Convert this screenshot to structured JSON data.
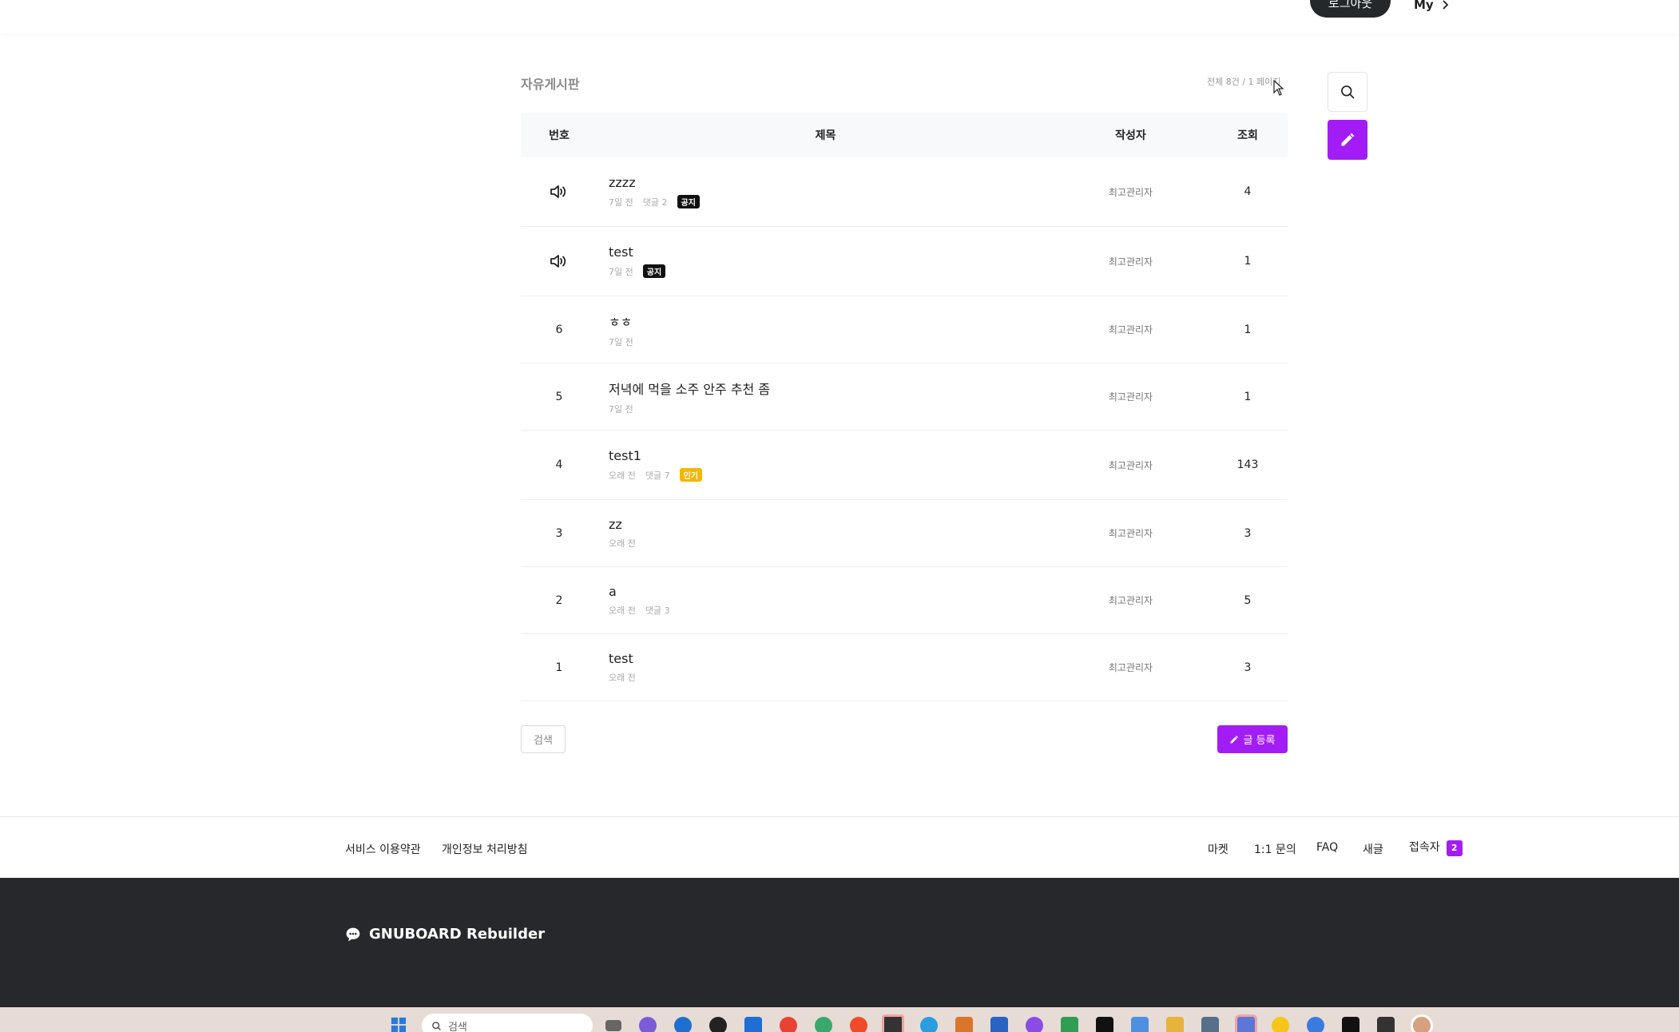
{
  "header": {
    "logout_label": "로그아웃",
    "my_label": "My"
  },
  "board": {
    "title": "자유게시판",
    "count_text": "전체 8건 / 1 페이지",
    "columns": {
      "num": "번호",
      "title": "제목",
      "author": "작성자",
      "views": "조회"
    },
    "rows": [
      {
        "num": "",
        "notice": true,
        "title": "zzzz",
        "time": "7일 전",
        "comments": "댓글 2",
        "badge": "공지",
        "badge_type": "notice",
        "author": "최고관리자",
        "views": "4"
      },
      {
        "num": "",
        "notice": true,
        "title": "test",
        "time": "7일 전",
        "comments": "",
        "badge": "공지",
        "badge_type": "notice",
        "author": "최고관리자",
        "views": "1"
      },
      {
        "num": "6",
        "notice": false,
        "title": "ㅎㅎ",
        "time": "7일 전",
        "comments": "",
        "badge": "",
        "badge_type": "",
        "author": "최고관리자",
        "views": "1"
      },
      {
        "num": "5",
        "notice": false,
        "title": "저녁에 먹을 소주 안주 추천 좀",
        "time": "7일 전",
        "comments": "",
        "badge": "",
        "badge_type": "",
        "author": "최고관리자",
        "views": "1"
      },
      {
        "num": "4",
        "notice": false,
        "title": "test1",
        "time": "오래 전",
        "comments": "댓글 7",
        "badge": "인기",
        "badge_type": "hot",
        "author": "최고관리자",
        "views": "143"
      },
      {
        "num": "3",
        "notice": false,
        "title": "zz",
        "time": "오래 전",
        "comments": "",
        "badge": "",
        "badge_type": "",
        "author": "최고관리자",
        "views": "3"
      },
      {
        "num": "2",
        "notice": false,
        "title": "a",
        "time": "오래 전",
        "comments": "댓글 3",
        "badge": "",
        "badge_type": "",
        "author": "최고관리자",
        "views": "5"
      },
      {
        "num": "1",
        "notice": false,
        "title": "test",
        "time": "오래 전",
        "comments": "",
        "badge": "",
        "badge_type": "",
        "author": "최고관리자",
        "views": "3"
      }
    ],
    "search_label": "검색",
    "write_label": "글 등록"
  },
  "footer": {
    "links_left": [
      "서비스 이용약관",
      "개인정보 처리방침"
    ],
    "links_right": [
      "마켓",
      "1:1 문의",
      "FAQ",
      "새글"
    ],
    "visitor_label": "접속자",
    "visitor_count": "2",
    "brand": "GNUBOARD Rebuilder"
  },
  "taskbar": {
    "search_placeholder": "검색"
  },
  "colors": {
    "accent": "#a21df5",
    "dark": "#26282b",
    "hot": "#f5b600"
  }
}
